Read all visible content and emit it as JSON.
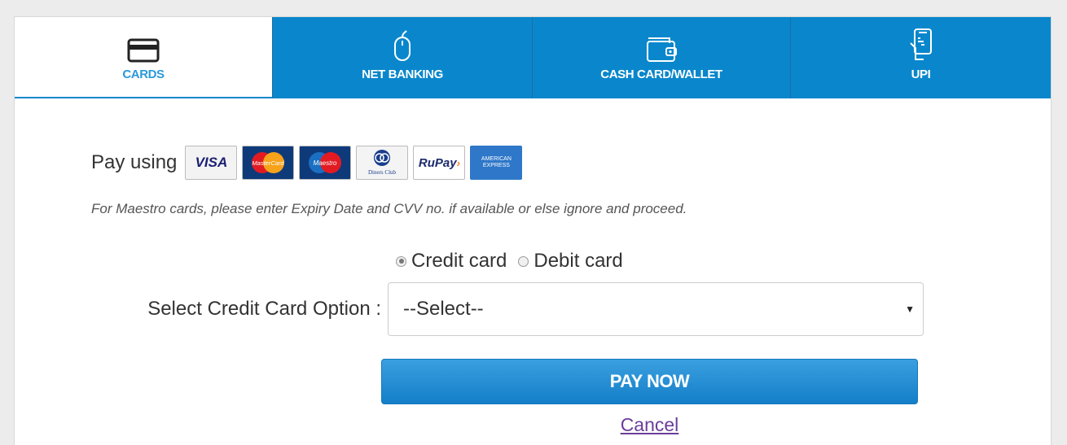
{
  "tabs": [
    {
      "label": "CARDS",
      "icon": "card-icon",
      "active": true
    },
    {
      "label": "NET BANKING",
      "icon": "mouse-icon",
      "active": false
    },
    {
      "label": "CASH CARD/WALLET",
      "icon": "wallet-icon",
      "active": false
    },
    {
      "label": "UPI",
      "icon": "phone-hand-icon",
      "active": false
    }
  ],
  "payment": {
    "pay_using_label": "Pay using",
    "logos": {
      "visa": "VISA",
      "mastercard": "MasterCard",
      "maestro": "Maestro",
      "diners": "Diners Club",
      "rupay": "RuPay",
      "amex": "AMERICAN EXPRESS"
    },
    "note": "For Maestro cards, please enter Expiry Date and CVV no. if available or else ignore and proceed.",
    "card_types": [
      {
        "label": "Credit card",
        "checked": true
      },
      {
        "label": "Debit card",
        "checked": false
      }
    ],
    "select_label": "Select Credit Card Option :",
    "select_value": "--Select--",
    "pay_button": "PAY NOW",
    "cancel_link": "Cancel"
  },
  "colors": {
    "tab_blue": "#0a87cc",
    "active_tab_text": "#2a9ad9",
    "button_blue": "#137fc8",
    "link_purple": "#6a3d9a"
  }
}
